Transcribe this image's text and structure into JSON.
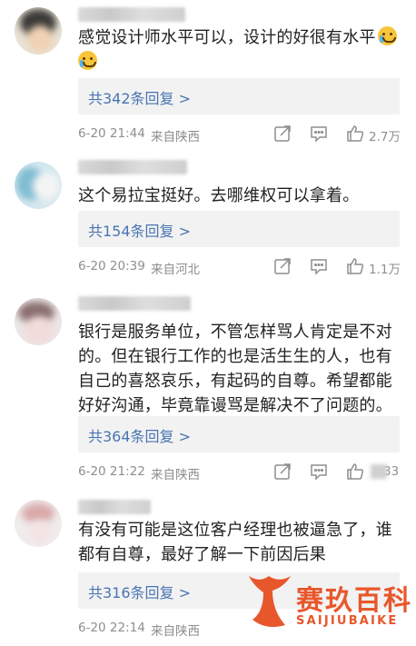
{
  "comments": [
    {
      "text": "感觉设计师水平可以，设计的好很有水平",
      "replies": "共342条回复 >",
      "time": "6-20 21:44",
      "location": "来自陕西",
      "likes": "2.7万"
    },
    {
      "text": "这个易拉宝挺好。去哪维权可以拿着。",
      "replies": "共154条回复 >",
      "time": "6-20 20:39",
      "location": "来自河北",
      "likes": "1.1万"
    },
    {
      "text": "银行是服务单位，不管怎样骂人肯定是不对的。但在银行工作的也是活生生的人，也有自己的喜怒哀乐，有起码的自尊。希望都能好好沟通，毕竟靠谩骂是解决不了问题的。",
      "replies": "共364条回复 >",
      "time": "6-20 21:22",
      "location": "来自陕西",
      "likes": "33"
    },
    {
      "text": "有没有可能是这位客户经理也被逼急了，谁都有自尊，最好了解一下前因后果",
      "replies": "共316条回复 >",
      "time": "6-20 22:14",
      "location": "来自陕西",
      "likes": ""
    }
  ],
  "watermark": {
    "title": "赛玖百科",
    "subtitle": "SAIJIUBAIKE"
  },
  "colors": {
    "link": "#4a74b3",
    "meta": "#8e8e8e",
    "reply_bg": "#f2f2f2",
    "brand": "#e8572b"
  }
}
